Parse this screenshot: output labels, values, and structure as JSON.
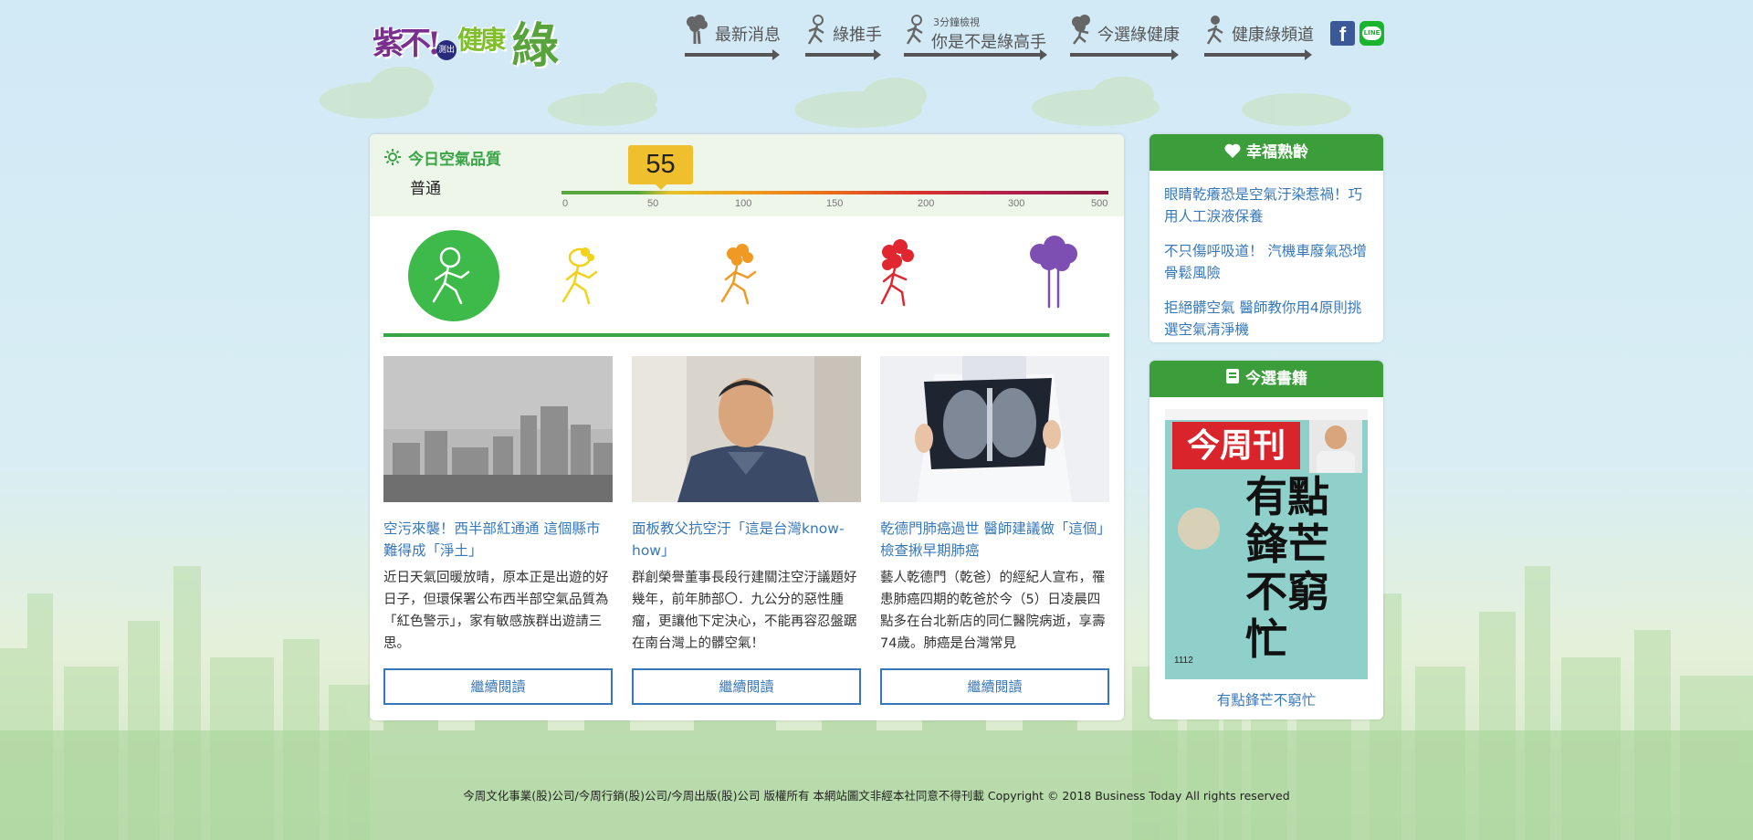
{
  "header": {
    "logo": {
      "part1": "紫不!",
      "badge": "測出",
      "part2": "健康",
      "part3": "綠"
    },
    "nav": [
      {
        "label": "最新消息"
      },
      {
        "label": "綠推手"
      },
      {
        "small": "3分鐘檢視",
        "label": "你是不是綠高手"
      },
      {
        "label": "今選綠健康"
      },
      {
        "label": "健康綠頻道"
      }
    ],
    "social": {
      "facebook": "f",
      "line": "LINE"
    }
  },
  "air_quality": {
    "title": "今日空氣品質",
    "status": "普通",
    "value": "55",
    "value_number": 55,
    "scale_ticks": [
      "0",
      "50",
      "100",
      "150",
      "200",
      "300",
      "500"
    ],
    "active_level": 0,
    "level_colors": [
      "#3dba4a",
      "#f2d21a",
      "#f09a24",
      "#e0262f",
      "#7e4fb3"
    ]
  },
  "articles": [
    {
      "title": "空污來襲！西半部紅通通 這個縣市難得成「淨土」",
      "body": "近日天氣回暖放晴，原本正是出遊的好日子，但環保署公布西半部空氣品質為「紅色警示」，家有敏感族群出遊請三思。",
      "button": "繼續閱讀"
    },
    {
      "title": "面板教父抗空汙「這是台灣know-how」",
      "body": "群創榮譽董事長段行建關注空汙議題好幾年，前年肺部〇．九公分的惡性腫瘤，更讓他下定決心，不能再容忍盤踞在南台灣上的髒空氣！",
      "button": "繼續閱讀"
    },
    {
      "title": "乾德門肺癌過世 醫師建議做「這個」檢查揪早期肺癌",
      "body": "藝人乾德門（乾爸）的經紀人宣布，罹患肺癌四期的乾爸於今（5）日凌晨四點多在台北新店的同仁醫院病逝，享壽74歲。肺癌是台灣常見",
      "button": "繼續閱讀"
    }
  ],
  "sidebar": {
    "happy_aging": {
      "title": "幸福熟齡",
      "links": [
        "眼睛乾癢恐是空氣汙染惹禍！巧用人工淚液保養",
        "不只傷呼吸道！ 汽機車廢氣恐增骨鬆風險",
        "拒絕髒空氣 醫師教你用4原則挑選空氣清淨機"
      ]
    },
    "books": {
      "title": "今選書籍",
      "cover_masthead": "今周刊",
      "cover_headline": "有點鋒芒不窮忙",
      "cover_issue": "1112",
      "book_title": "有點鋒芒不窮忙"
    }
  },
  "footer": "今周文化事業(股)公司/今周行銷(股)公司/今周出版(股)公司 版權所有 本網站圖文非經本社同意不得刊載 Copyright © 2018 Business Today All rights reserved"
}
